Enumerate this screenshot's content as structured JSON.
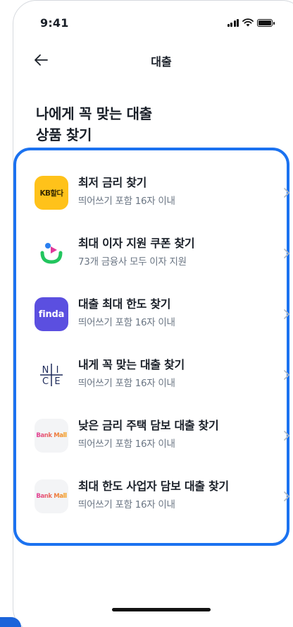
{
  "status_bar": {
    "time": "9:41"
  },
  "nav": {
    "title": "대출"
  },
  "heading": {
    "line1": "나에게 꼭 맞는 대출",
    "line2": "상품 찾기"
  },
  "items": [
    {
      "logo_text": "KB할다",
      "title": "최저 금리 찾기",
      "subtitle": "띄어쓰기 포함 16자 이내"
    },
    {
      "logo_text": "",
      "title": "최대 이자 지원 쿠폰 찾기",
      "subtitle": "73개 금융사 모두 이자 지원"
    },
    {
      "logo_text": "finda",
      "title": "대출 최대 한도 찾기",
      "subtitle": "띄어쓰기 포함 16자 이내"
    },
    {
      "logo_text": "NICE",
      "title": "내게 꼭 맞는 대출 찾기",
      "subtitle": "띄어쓰기 포함 16자 이내"
    },
    {
      "logo_text": "Bank Mall",
      "title": "낮은 금리 주택 담보 대출 찾기",
      "subtitle": "띄어쓰기 포함 16자 이내"
    },
    {
      "logo_text": "Bank Mall",
      "title": "최대 한도 사업자 담보 대출 찾기",
      "subtitle": "띄어쓰기 포함 16자 이내"
    }
  ],
  "colors": {
    "accent_frame": "#1b72f0",
    "title_text": "#191f28",
    "sub_text": "#6b7684",
    "kb_yellow": "#ffc21a",
    "finda_purple": "#5b4fe0"
  }
}
